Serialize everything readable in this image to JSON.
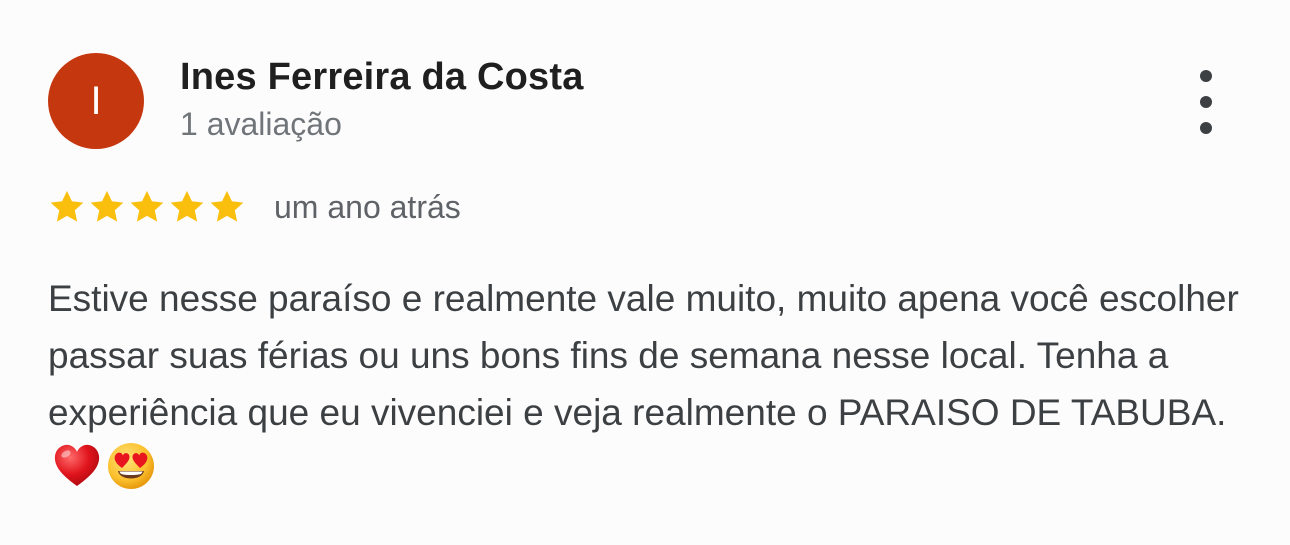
{
  "review": {
    "avatar_initial": "I",
    "author_name": "Ines Ferreira da Costa",
    "review_count": "1 avaliação",
    "rating": 5,
    "rating_max": 5,
    "date": "um ano atrás",
    "text": "Estive nesse paraíso e realmente vale muito, muito apena você escolher passar suas férias ou uns bons fins de semana nesse local. Tenha a experiência que eu vivenciei e veja realmente o PARAISO DE TABUBA.",
    "emojis": [
      "red-heart-emoji",
      "heart-eyes-emoji"
    ]
  },
  "icons": {
    "menu": "more-vert-icon",
    "star": "star-icon"
  },
  "colors": {
    "avatar_bg": "#c5380f",
    "star": "#f9bf0c",
    "background": "#fdfcfd"
  }
}
